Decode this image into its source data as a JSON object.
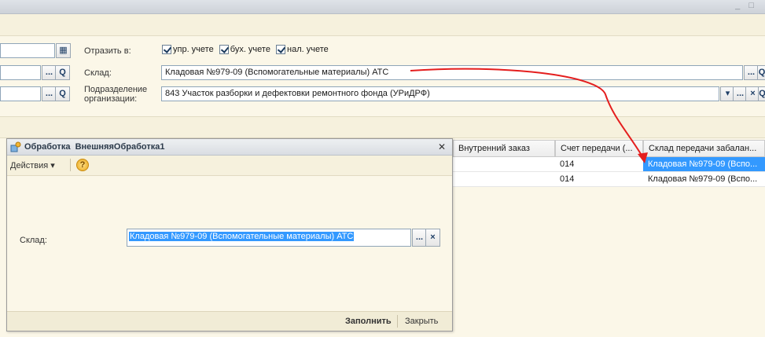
{
  "header": {
    "reflect_label": "Отразить в:",
    "checks": [
      "упр. учете",
      "бух. учете",
      "нал. учете"
    ],
    "warehouse_label": "Склад:",
    "warehouse_value": "Кладовая №979-09 (Вспомогательные материалы) АТС",
    "division_label_1": "Подразделение",
    "division_label_2": "организации:",
    "division_value": "843 Участок разборки и дефектовки ремонтного фонда (УРиДРФ)"
  },
  "table": {
    "columns": [
      "Внутренний заказ",
      "Счет передачи (...",
      "Склад передачи забалан..."
    ],
    "rows": [
      [
        "",
        "014",
        "Кладовая №979-09 (Вспо..."
      ],
      [
        "",
        "014",
        "Кладовая №979-09 (Вспо..."
      ]
    ]
  },
  "dialog": {
    "title_prefix": "Обработка",
    "title_name": "ВнешняяОбработка1",
    "actions_label": "Действия",
    "field_label": "Склад:",
    "field_value": "Кладовая №979-09 (Вспомогательные материалы) АТС",
    "fill_button": "Заполнить",
    "close_button": "Закрыть"
  },
  "glyphs": {
    "search": "Q",
    "ellipsis": "...",
    "clear": "×",
    "dropdown": "▾",
    "help": "?",
    "close": "✕",
    "menu_arrow": "▾",
    "calendar": "▦"
  },
  "colors": {
    "selection": "#3399ff",
    "annotation_arrow": "#e41e1e"
  }
}
